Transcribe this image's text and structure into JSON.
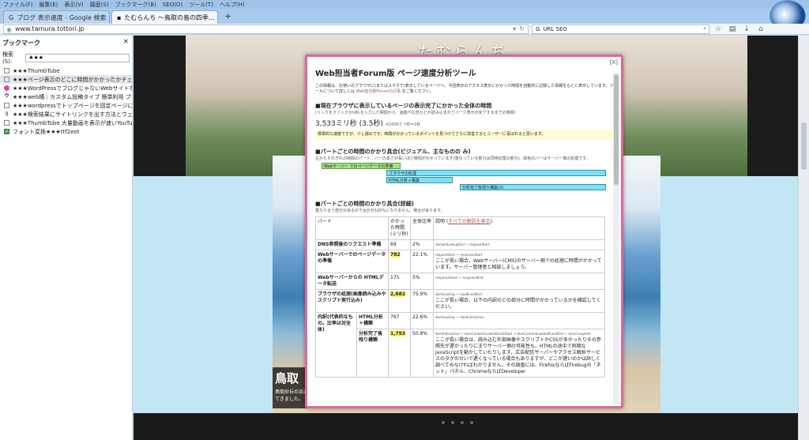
{
  "menu": [
    "ファイル(F)",
    "編集(E)",
    "表示(V)",
    "履歴(S)",
    "ブックマーク(B)",
    "SEO(O)",
    "ツール(T)",
    "ヘルプ(H)"
  ],
  "tabs": [
    {
      "label": "ブログ 表示速度 - Google 検索"
    },
    {
      "label": "たむらんち 〜鳥取の島の四季..."
    }
  ],
  "url": "www.tamura.tottori.jp",
  "search_text": "URL SEO",
  "sidebar": {
    "title": "ブックマーク",
    "close": "×",
    "search_label": "検索(S):",
    "search_value": "★★★",
    "items": [
      {
        "label": "★★★ThumbTube"
      },
      {
        "label": "★★★ページ表示のどこに時間がかかったかチェック"
      },
      {
        "label": "★★★WordPressでブログじゃないWebサイトを作るための..."
      },
      {
        "label": "★★★web構｜カスタム投稿タイプ 簡単利用 プラグイン..."
      },
      {
        "label": "★★★wordpressでトップページを固定ページに設定して新..."
      },
      {
        "label": "★★★検索結果にサイトリンクを出す方法とウェブマスター..."
      },
      {
        "label": "★★★ThumbTube 大量動画を表示が速いYouTubeサ..."
      },
      {
        "label": "フォント変換★★★ttf2eot"
      }
    ]
  },
  "site": {
    "title": "たむらんち",
    "caption_h": "鳥取",
    "caption_p": "鳥取砂丘の浜辺を見てきました。"
  },
  "modal": {
    "close": "[X]",
    "heading": "Web担当者Forum版 ページ速度分析ツール",
    "intro": "この情報は、お使いのブラウザに(またはスマホで)表示しているページへ、今回表示のアクセス表示にかかった時間を自動的に記録した情報をもとに表示しています。ツールについて詳しくは",
    "intro_link": "Web担当者Forumの記事",
    "intro_tail": "をご覧ください。",
    "s1_title": "■現在ブラウザに表示しているページの表示完了にかかった全体の時間",
    "s1_sub": "(リンクをクリックかURLを入力した瞬間から、画像や広告などが読み込まれてページ表示が完了するまでの時間)",
    "s1_value": "3,533ミリ秒 (3.5秒)",
    "s1_unit": "※1000ミリ秒=1秒",
    "s1_note": "標準的な速度ですが、少し遅めです。時間がかかっているポイントを見つけてさらに改善するとユーザーに喜ばれると思います。",
    "s2_title": "■パートごとの時間のかかり具合(ビジュアル、主なものの み)",
    "s2_sub": "左からそれぞれの時間のパート、バーの長さが長いほど時間がかかっています(重なっている部分は同時処理の部分)。緑色のバーはサーバー側の処理です。",
    "bars": [
      "Webサーバー でのページデータの準備",
      "ブラウザの処理",
      "HTML分析＋構築",
      "分析完了後残り構築(2)"
    ],
    "s3_title": "■パートごとの時間のかかり具合(詳細)",
    "s3_sub": "重なり合う部分があるので合計が100%になりません。場合があります。",
    "table_head": [
      "パート",
      "かかった時間(ミリ秒)",
      "全体比率",
      "説明 (",
      "すべての解説を表示",
      ")"
    ],
    "rows": [
      {
        "part": "DNS参照後のリクエスト準備",
        "time": "69",
        "ratio": "2%",
        "code": "domainLookupEnd 〜 requestStart",
        "desc": ""
      },
      {
        "part": "Webサーバーでのページデータの準備",
        "time": "782",
        "ratio": "22.1%",
        "code": "requestStart 〜 responseStart",
        "desc": "ここが長い場合、Webサーバー(CMS)のサーバー側での処理に時間がかかっています。サーバー管理者と相談しましょう。"
      },
      {
        "part": "Webサーバーからの HTMLデータ転送",
        "time": "175",
        "ratio": "5%",
        "code": "responseStart 〜 responseEnd",
        "desc": ""
      },
      {
        "part": "ブラウザの処理(画像読み込みやスクリプト実行込み)",
        "time": "2,682",
        "ratio": "75.9%",
        "code": "domLoading 〜 loadEventEnd",
        "desc": "ここが長い場合、以下の内訳のどの部分に時間がかかっているかを確認してください。"
      }
    ],
    "sub_group": "内訳(代表的なもの。比率は対全体)",
    "sub_rows": [
      {
        "part": "HTML分析＋構築",
        "time": "797",
        "ratio": "22.6%",
        "code": "domLoading 〜 domInteractive",
        "desc": ""
      },
      {
        "part": "分析完了後残り構築",
        "time": "1,793",
        "ratio": "50.8%",
        "code": "domInteractive 〜 domContentLoadedEventStart + domContentLoadedEventEnd 〜 domComplete",
        "desc": "ここが長い場合は、読み込む外部画像やスクリプトやCSSが多かったりその参照先が遅かったりにまりサーバー側の可能性も。HTMLの途中で同期なJavaScriptを動かしていたりします。広告配信サーバーやアクセス解析サービスのタグのせいで遅くなっている場合もありますが、どこが遅いのかは詳しく調べてみなければわかりません。その調査には、FirefoxならばFirebugの「ネット」パネル、ChromeならばDeveloper"
      }
    ],
    "highlighted_times": [
      "782",
      "2,682",
      "1,793"
    ]
  },
  "chart_data": {
    "type": "table",
    "categories": [
      "DNS参照後のリクエスト準備",
      "Webサーバーでのページデータの準備",
      "Webサーバーからの HTMLデータ転送",
      "ブラウザの処理(画像読み込みやスクリプト実行込み)",
      "HTML分析＋構築",
      "分析完了後残り構築"
    ],
    "values": [
      69,
      782,
      175,
      2682,
      797,
      1793
    ],
    "ratios": [
      "2%",
      "22.1%",
      "5%",
      "75.9%",
      "22.6%",
      "50.8%"
    ]
  },
  "colors": {
    "accent_border": "#e0679c",
    "highlight": "#fff35a",
    "server_bar": "#a9e08a",
    "browser_bar": "#7fe0f2"
  }
}
